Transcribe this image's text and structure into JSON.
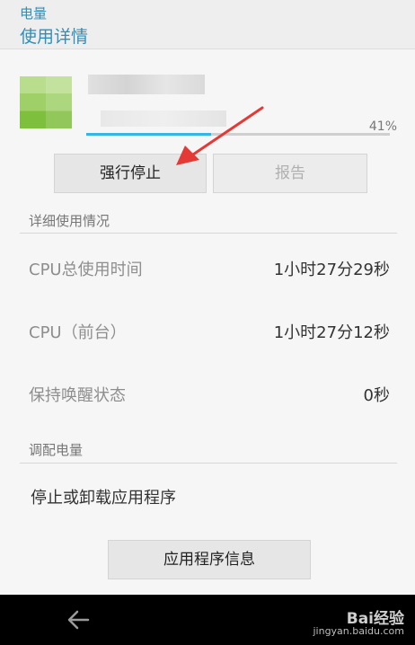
{
  "header": {
    "crumb": "电量",
    "title": "使用详情"
  },
  "app": {
    "percent": "41%",
    "progress_fraction": 0.41,
    "accent": "#33b5e5"
  },
  "buttons": {
    "force_stop": "强行停止",
    "report": "报告",
    "app_info": "应用程序信息"
  },
  "details": {
    "section_title": "详细使用情况",
    "rows": [
      {
        "label": "CPU总使用时间",
        "value": "1小时27分29秒"
      },
      {
        "label": "CPU（前台）",
        "value": "1小时27分12秒"
      },
      {
        "label": "保持唤醒状态",
        "value": "0秒"
      }
    ]
  },
  "adjust": {
    "section_title": "调配电量",
    "stop_uninstall": "停止或卸载应用程序"
  },
  "navbar": {
    "back_icon": "back-arrow-icon"
  },
  "watermark": {
    "brand": "Bai经验",
    "url": "jingyan.baidu.com"
  },
  "colors": {
    "header_text": "#2e8fb8",
    "annotation_arrow": "#e53935"
  }
}
